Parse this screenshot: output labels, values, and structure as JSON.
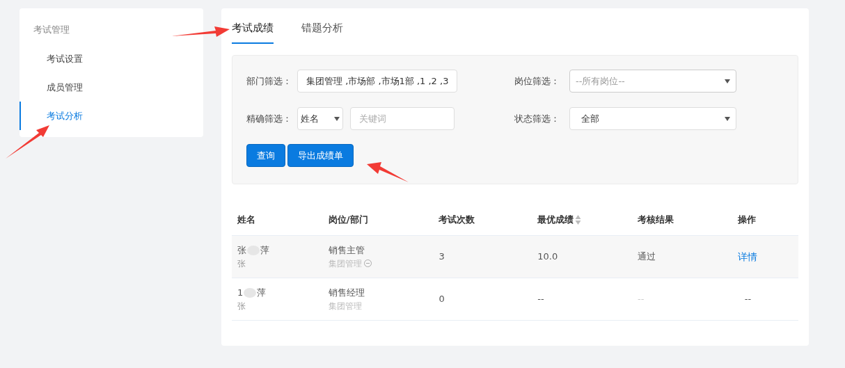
{
  "sidebar": {
    "title": "考试管理",
    "items": [
      {
        "label": "考试设置",
        "selected": false
      },
      {
        "label": "成员管理",
        "selected": false
      },
      {
        "label": "考试分析",
        "selected": true
      }
    ]
  },
  "tabs": [
    {
      "label": "考试成绩",
      "selected": true
    },
    {
      "label": "错题分析",
      "selected": false
    }
  ],
  "filters": {
    "department": {
      "label": "部门筛选：",
      "value": "集团管理 ,市场部 ,市场1部 ,1 ,2 ,3"
    },
    "position": {
      "label": "岗位筛选：",
      "placeholder": "--所有岗位--"
    },
    "exact": {
      "label": "精确筛选：",
      "field": "姓名",
      "placeholder": "关键词"
    },
    "status": {
      "label": "状态筛选：",
      "value": "全部"
    }
  },
  "buttons": [
    "查询",
    "导出成绩单"
  ],
  "table": {
    "columns": [
      "姓名",
      "岗位/部门",
      "考试次数",
      "最优成绩",
      "考核结果",
      "操作"
    ],
    "rows": [
      {
        "name_start": "张",
        "name_end": "萍",
        "sub_start": "张",
        "position": "销售主管",
        "department": "集团管理",
        "dept_more": true,
        "count": "3",
        "best": "10.0",
        "result": "通过",
        "result_muted": false,
        "action": "详情",
        "action_link": true,
        "highlighted": true
      },
      {
        "name_start": "1",
        "name_end": "萍",
        "sub_start": "张",
        "position": "销售经理",
        "department": "集团管理",
        "dept_more": false,
        "count": "0",
        "best": "--",
        "result": "--",
        "result_muted": true,
        "action": "--",
        "action_link": false,
        "highlighted": false
      }
    ]
  }
}
